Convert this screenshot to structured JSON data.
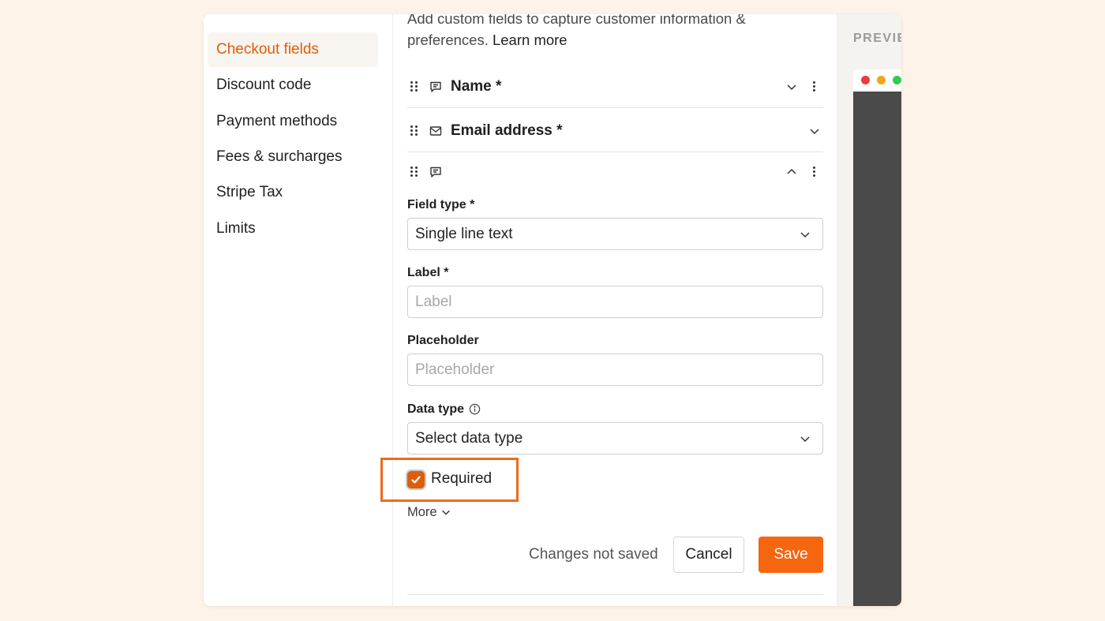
{
  "sidebar": {
    "items": [
      {
        "label": "Checkout fields",
        "active": true
      },
      {
        "label": "Discount code"
      },
      {
        "label": "Payment methods"
      },
      {
        "label": "Fees & surcharges"
      },
      {
        "label": "Stripe Tax"
      },
      {
        "label": "Limits"
      }
    ]
  },
  "intro": {
    "text": "Add custom fields to capture customer information & preferences.",
    "link": "Learn more"
  },
  "fields": [
    {
      "title": "Name *",
      "icon": "message-square-icon",
      "expanded": false
    },
    {
      "title": "Email address *",
      "icon": "mail-icon",
      "expanded": false
    },
    {
      "title": "",
      "icon": "message-square-icon",
      "expanded": true
    }
  ],
  "editor": {
    "field_type_label": "Field type *",
    "field_type_value": "Single line text",
    "label_label": "Label *",
    "label_placeholder": "Label",
    "placeholder_label": "Placeholder",
    "placeholder_placeholder": "Placeholder",
    "data_type_label": "Data type",
    "data_type_value": "Select data type",
    "required_label": "Required",
    "required_checked": true,
    "more_label": "More"
  },
  "footer": {
    "status": "Changes not saved",
    "cancel_label": "Cancel",
    "save_label": "Save"
  },
  "preview": {
    "label": "PREVIEW"
  },
  "colors": {
    "accent": "#de5e0a",
    "save_button": "#f5660f",
    "highlight": "#ec6b1d",
    "background": "#fdf3e8"
  }
}
